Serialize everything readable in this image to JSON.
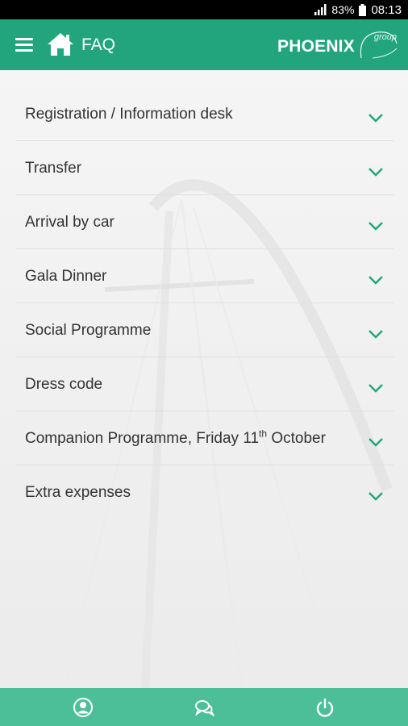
{
  "status_bar": {
    "battery_percent": "83%",
    "time": "08:13",
    "icons": [
      "signal-icon",
      "battery-icon"
    ]
  },
  "app_bar": {
    "title": "FAQ",
    "menu_icon": "menu-icon",
    "home_icon": "home-icon",
    "brand": "PHOENIX",
    "brand_suffix": "group",
    "color": "#22a57c"
  },
  "faq": {
    "items": [
      {
        "label": "Registration / Information desk"
      },
      {
        "label": "Transfer"
      },
      {
        "label": "Arrival by car"
      },
      {
        "label": "Gala Dinner"
      },
      {
        "label": "Social Programme"
      },
      {
        "label": "Dress code"
      },
      {
        "label_prefix": "Companion Programme, Friday 11",
        "label_sup": "th",
        "label_suffix": " October"
      },
      {
        "label": "Extra expenses"
      }
    ],
    "chevron_icon": "chevron-down-icon",
    "accent": "#22a57c"
  },
  "bottom_bar": {
    "color": "#4cbf99",
    "icons": [
      "profile-icon",
      "chat-icon",
      "power-icon"
    ]
  }
}
